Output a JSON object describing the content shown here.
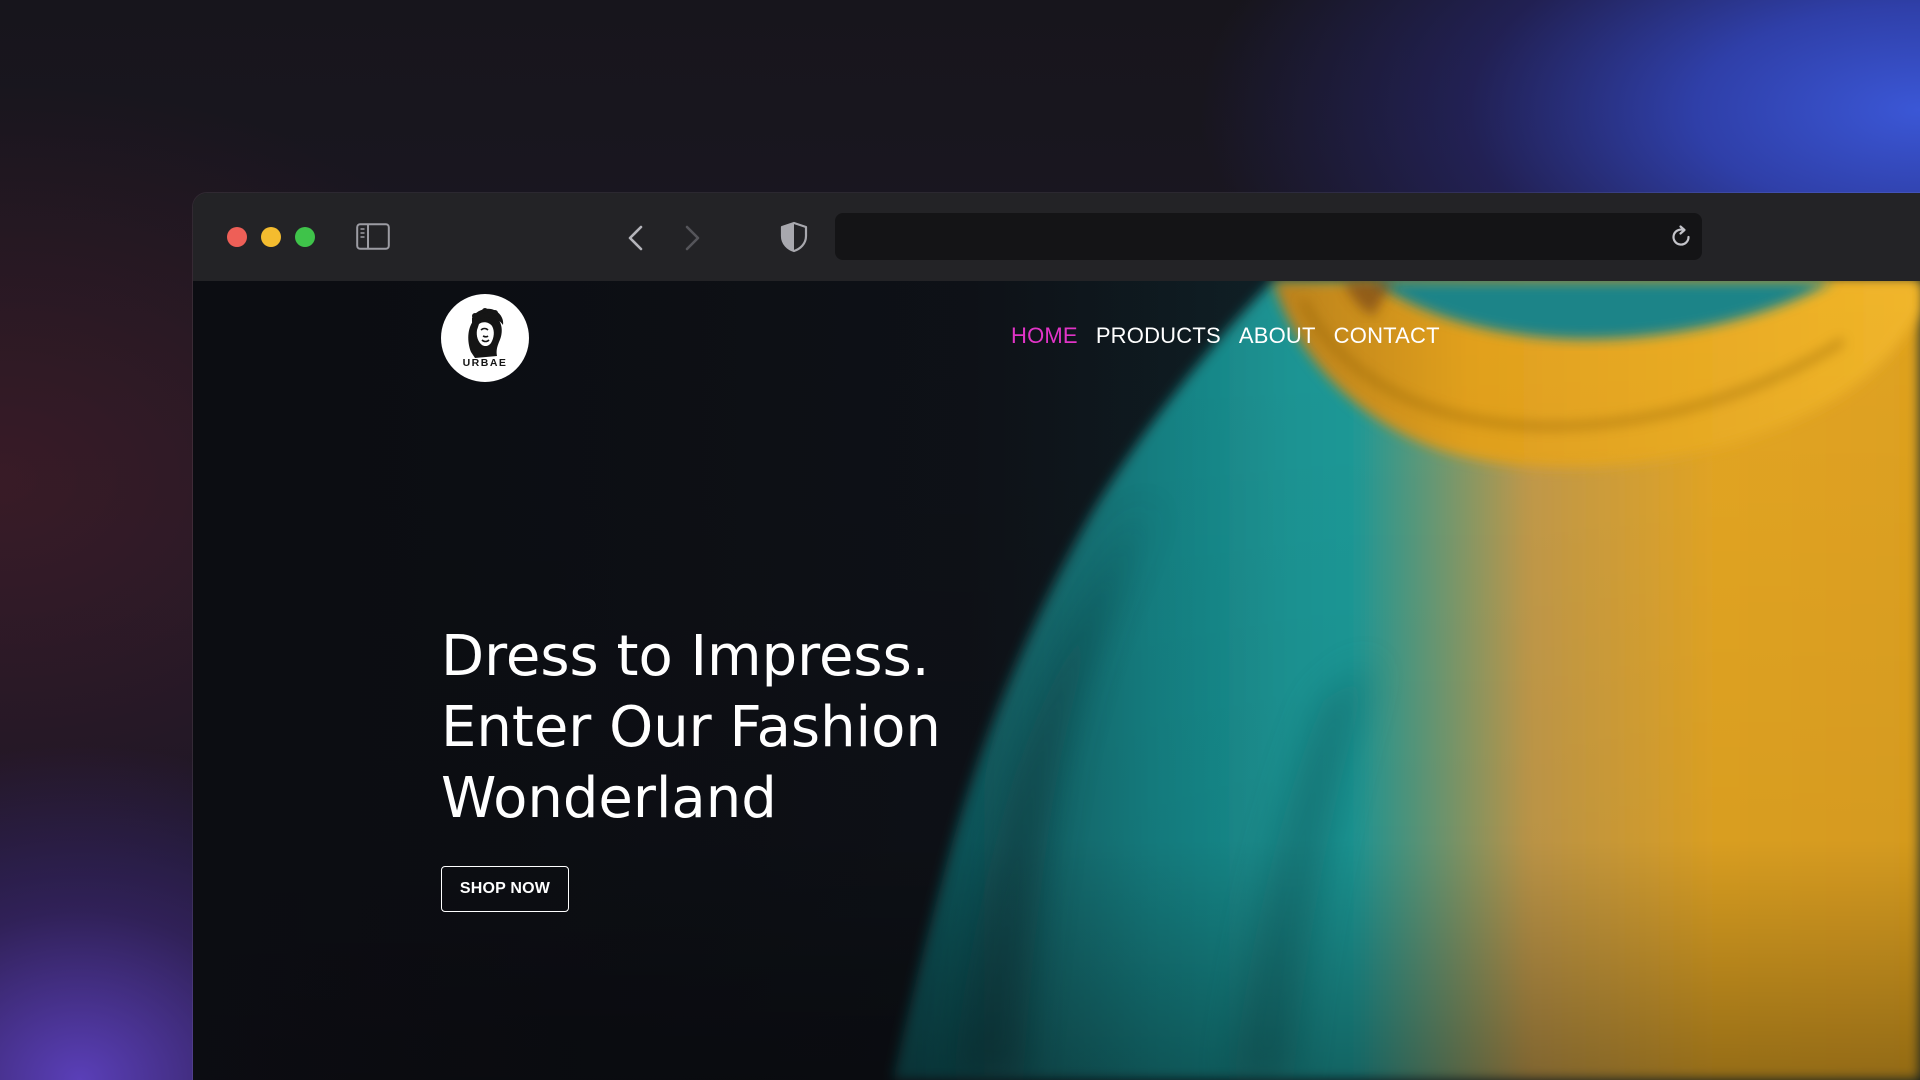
{
  "browser": {
    "address_bar_value": "",
    "icons": {
      "sidebar": "sidebar-icon",
      "back": "chevron-left-icon",
      "forward": "chevron-right-icon",
      "privacy": "shield-icon",
      "reload": "reload-icon"
    },
    "traffic_lights": {
      "close": "#ee5f57",
      "minimize": "#f4bc2f",
      "maximize": "#3fc34a"
    }
  },
  "site": {
    "logo": {
      "text": "URBAE"
    },
    "nav": [
      {
        "label": "HOME",
        "active": true
      },
      {
        "label": "PRODUCTS",
        "active": false
      },
      {
        "label": "ABOUT",
        "active": false
      },
      {
        "label": "CONTACT",
        "active": false
      }
    ],
    "hero": {
      "headline_lines": [
        "Dress to Impress.",
        "Enter Our Fashion",
        "Wonderland"
      ],
      "cta_label": "SHOP NOW"
    },
    "colors": {
      "nav_active": "#e134c7",
      "nav_default": "#ffffff",
      "shirt_body": "#1a8e8e",
      "shirt_collar": "#e6a91c",
      "page_background": "#0c0d12"
    }
  }
}
